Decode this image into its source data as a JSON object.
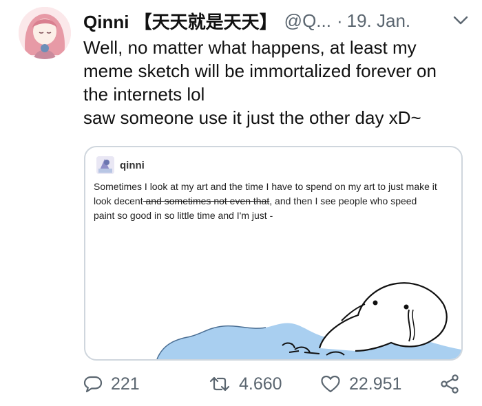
{
  "tweet": {
    "display_name": "Qinni 【天天就是天天】",
    "handle": "@Q...",
    "separator": "·",
    "date": "19. Jan.",
    "text_lines": [
      "Well, no matter what happens, at least my",
      "meme sketch will be immortalized forever on",
      "the internets lol",
      "saw someone use it just the other day xD~"
    ]
  },
  "embedded_post": {
    "username": "qinni",
    "line1": "Sometimes I look at my art and the time I have to spend on my art to just make it",
    "line2_before": "look decent",
    "line2_struck": " and sometimes not even that",
    "line2_after": ", and then I see people who speed",
    "line3": "paint so good in so little time and I'm just -"
  },
  "actions": {
    "replies": "221",
    "retweets": "4.660",
    "likes": "22.951"
  },
  "icons": {
    "menu": "chevron-down-icon",
    "reply": "speech-bubble-icon",
    "retweet": "retweet-icon",
    "like": "heart-icon",
    "share": "share-icon"
  },
  "colors": {
    "text": "#111111",
    "secondary": "#5b6670",
    "card_border": "#cfd6dd",
    "meme_blue": "#a9cff0"
  }
}
